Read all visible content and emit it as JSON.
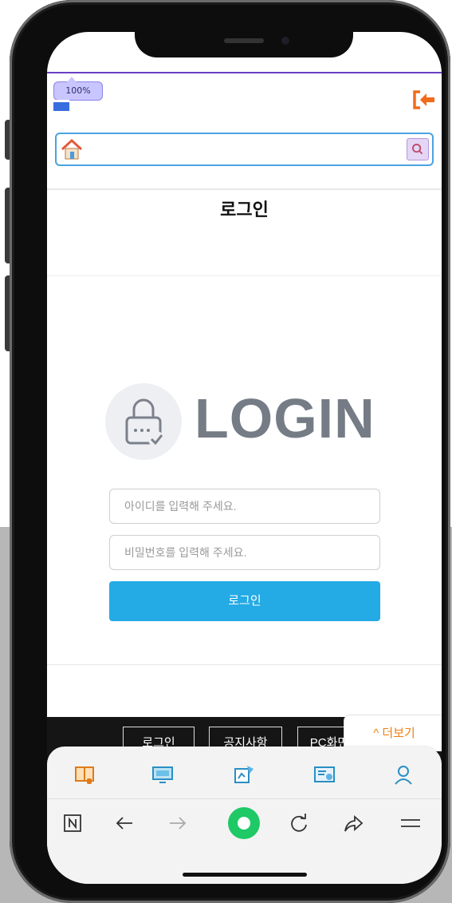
{
  "browser": {
    "zoom_level": "100%",
    "address_value": "",
    "accent_color": "#6a3fc4"
  },
  "page": {
    "title": "로그인",
    "logo_text": "LOGIN",
    "id_placeholder": "아이디를 입력해 주세요.",
    "password_placeholder": "비밀번호를 입력해 주세요.",
    "login_button_label": "로그인",
    "button_color": "#24aae4"
  },
  "footer": {
    "links": [
      "로그인",
      "공지사항",
      "PC화면"
    ],
    "more_label": "^ 더보기"
  },
  "toolbar": {
    "items": [
      "book-icon",
      "monitor-icon",
      "puzzle-icon",
      "certificate-icon",
      "user-icon"
    ]
  },
  "bottom_nav": {
    "items": [
      "naver-icon",
      "back-icon",
      "forward-icon",
      "green-dot-icon",
      "reload-icon",
      "share-icon",
      "menu-icon"
    ]
  }
}
